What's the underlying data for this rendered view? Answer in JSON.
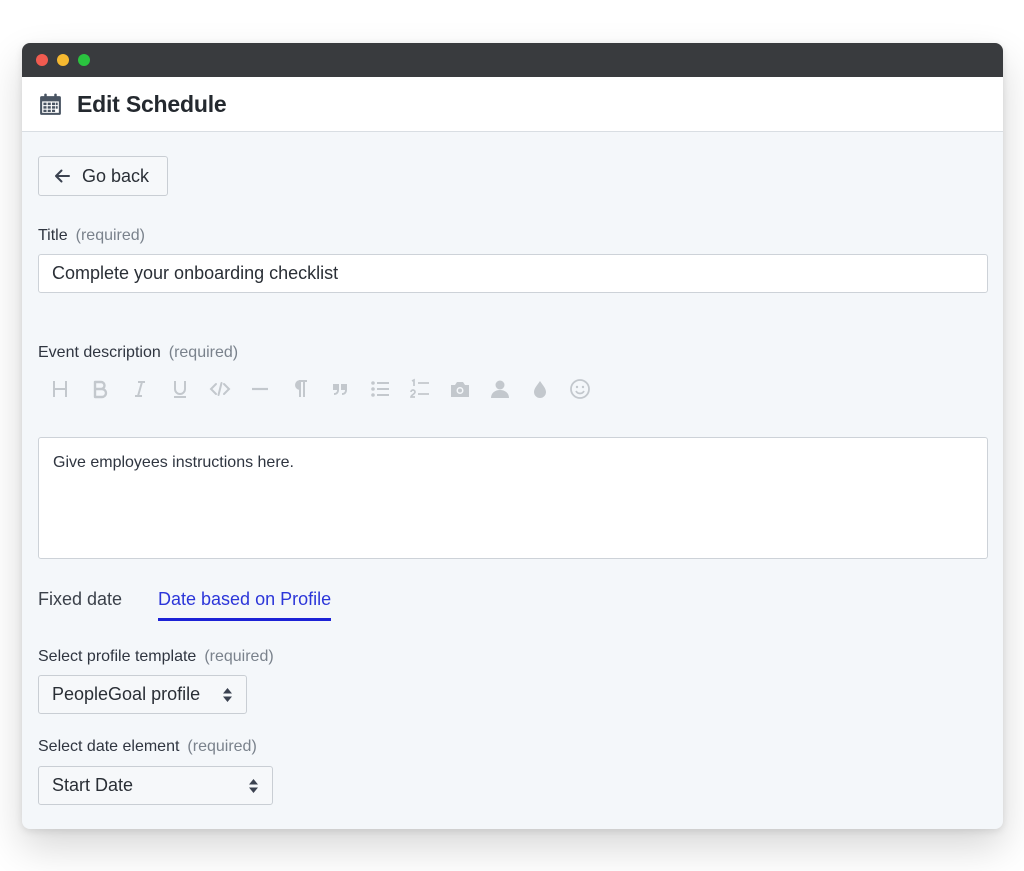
{
  "header": {
    "title": "Edit Schedule",
    "icon": "calendar-icon"
  },
  "back_button": {
    "label": "Go back",
    "icon": "arrow-left-icon"
  },
  "title_field": {
    "label": "Title",
    "required": "(required)",
    "value": "Complete your onboarding checklist"
  },
  "description_field": {
    "label": "Event description",
    "required": "(required)",
    "value": "Give employees instructions here.",
    "toolbar": [
      "heading-icon",
      "bold-icon",
      "italic-icon",
      "underline-icon",
      "code-icon",
      "horizontal-rule-icon",
      "paragraph-icon",
      "quote-icon",
      "bullet-list-icon",
      "ordered-list-icon",
      "image-icon",
      "user-icon",
      "color-drop-icon",
      "emoji-icon"
    ]
  },
  "date_tabs": {
    "fixed": "Fixed date",
    "profile": "Date based on Profile",
    "active": "profile"
  },
  "profile_template": {
    "label": "Select profile template",
    "required": "(required)",
    "value": "PeopleGoal profile"
  },
  "date_element": {
    "label": "Select date element",
    "required": "(required)",
    "value": "Start Date"
  },
  "colors": {
    "accent": "#1c22d6",
    "toolbar_icon": "#c3c8cd",
    "titlebar": "#393b3e",
    "content_bg": "#f4f7fa"
  }
}
